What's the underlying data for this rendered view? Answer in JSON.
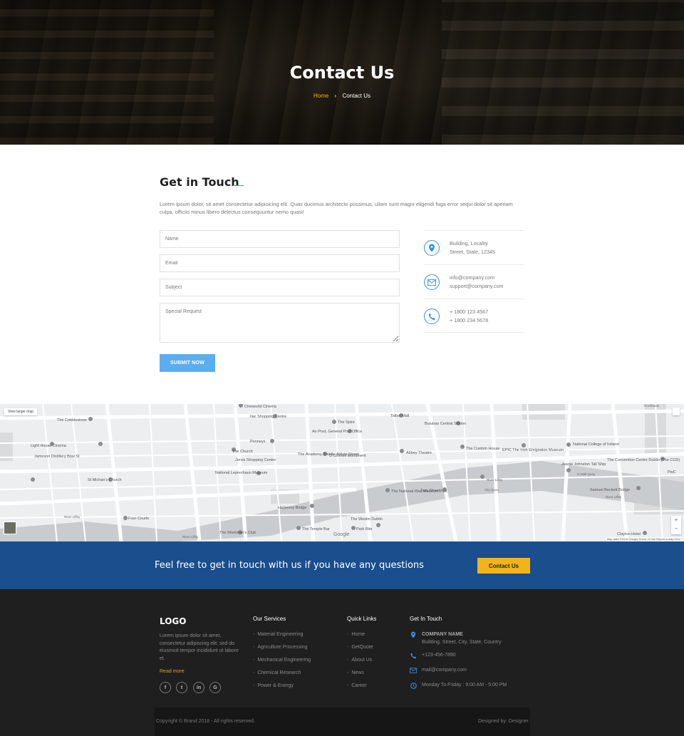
{
  "hero": {
    "title": "Contact Us",
    "breadcrumb_home": "Home",
    "breadcrumb_sep": "›",
    "breadcrumb_current": "Contact Us"
  },
  "get_in_touch": {
    "title": "Get in Touch",
    "intro": "Lorem ipsum dolor, sit amet consectetur adipisicing elit. Quas ducimus architecto possimus, ullam sunt magni eligendi fuga error sequi dolor sit aperiam culpa, officiis minus libero delectus consequuntur nemo quasi!"
  },
  "form": {
    "name_placeholder": "Name",
    "email_placeholder": "Email",
    "subject_placeholder": "Subject",
    "request_placeholder": "Special Request",
    "submit_label": "SUBMIT NOW"
  },
  "contact_info": {
    "address_line1": "Building, Locality",
    "address_line2": "Street, State, 12345",
    "email_line1": "info@company.com",
    "email_line2": "support@company.com",
    "phone_line1": "+ 1800 123 4567",
    "phone_line2": "+ 1800 234 5678"
  },
  "map": {
    "view_larger": "View larger map",
    "footer_text": "Map data ©2018 Google   Terms of Use   Report a map error",
    "google": "Google",
    "labels": {
      "cineworld": "Cineworld Cinema",
      "ilac": "Ilac Shopping Centre",
      "talbot": "Talbot Mall",
      "busaras": "Busáras Central Station",
      "cobblestone": "The Cobblestone",
      "spire": "The Spire",
      "anpost": "An Post, General Post Office",
      "penneys1": "Penneys",
      "lighthouse": "Light House Cinema",
      "jameson": "Jameson Distillery Bow St",
      "church": "The Church",
      "academy": "The Academy, Middle Abbey Street",
      "abbey": "Abbey Theatre",
      "customhouse": "The Custom House",
      "epic": "EPIC The Irish Emigration Museum",
      "college": "National College of Ireland",
      "jervis": "Jervis Shopping Centre",
      "penneys2": "Penneys",
      "oconnell": "O'Connell Monument",
      "convention": "The Convention Centre Dublin (The CCD)",
      "jeanie": "Jeanie Johnston Tall Ship",
      "leprechaun": "National Leprechaun Museum",
      "stmichan": "St Michan's Church",
      "wax": "The National Wax Museum Plus",
      "tara": "Tara Street",
      "samuel": "Samuel Beckett Bridge",
      "fourcourts": "Four Courts",
      "hapenny": "Ha'penny Bridge",
      "westin": "The Westin Dublin",
      "templebar": "The Temple Bar",
      "parkrite": "Park Rite",
      "clayton": "Clayton Hotel",
      "workmans": "The Workman's Club",
      "riverliffey1": "River Liffey",
      "riverliffey2": "River Liffey",
      "riverliffey3": "River Liffey",
      "riverliffey4": "River Liffey",
      "cityquay": "City Quay",
      "nwall": "N Wall Quay",
      "pwc": "PwC",
      "docklands": "Docklands"
    }
  },
  "cta": {
    "text": "Feel free to get in touch with us if you have any questions",
    "button": "Contact Us"
  },
  "footer": {
    "logo": "LOGO",
    "about": "Lorem ipsum dolor sit amet, consectetur adipiscing elit, sed do eiusmod tempor incididunt ut labore et.",
    "read_more": "Read more",
    "social": [
      "f",
      "t",
      "in",
      "G"
    ],
    "services_heading": "Our Services",
    "services": [
      "Material Engineering",
      "Agriculture Processing",
      "Mechanical Engineering",
      "Chemical Research",
      "Power & Energy"
    ],
    "quicklinks_heading": "Quick Links",
    "quicklinks": [
      "Home",
      "GetQuote",
      "About Us",
      "News",
      "Career"
    ],
    "touch_heading": "Get In Touch",
    "company_name": "COMPANY NAME",
    "company_address": "Building, Street, City, State, Country",
    "phone": "+123-456-7890",
    "email": "mail@company.com",
    "hours": "Monday To Friday : 9:00 AM - 5:00 PM",
    "copyright": "Copyright © Brand 2018 - All rights reserved.",
    "designed_by": "Designed by: Designer"
  },
  "colors": {
    "accent_blue": "#3b8fe0",
    "submit_blue": "#5aaef0",
    "cta_band": "#1a4e8c",
    "cta_button": "#f2b41a",
    "footer_bg": "#1f1f1f"
  }
}
